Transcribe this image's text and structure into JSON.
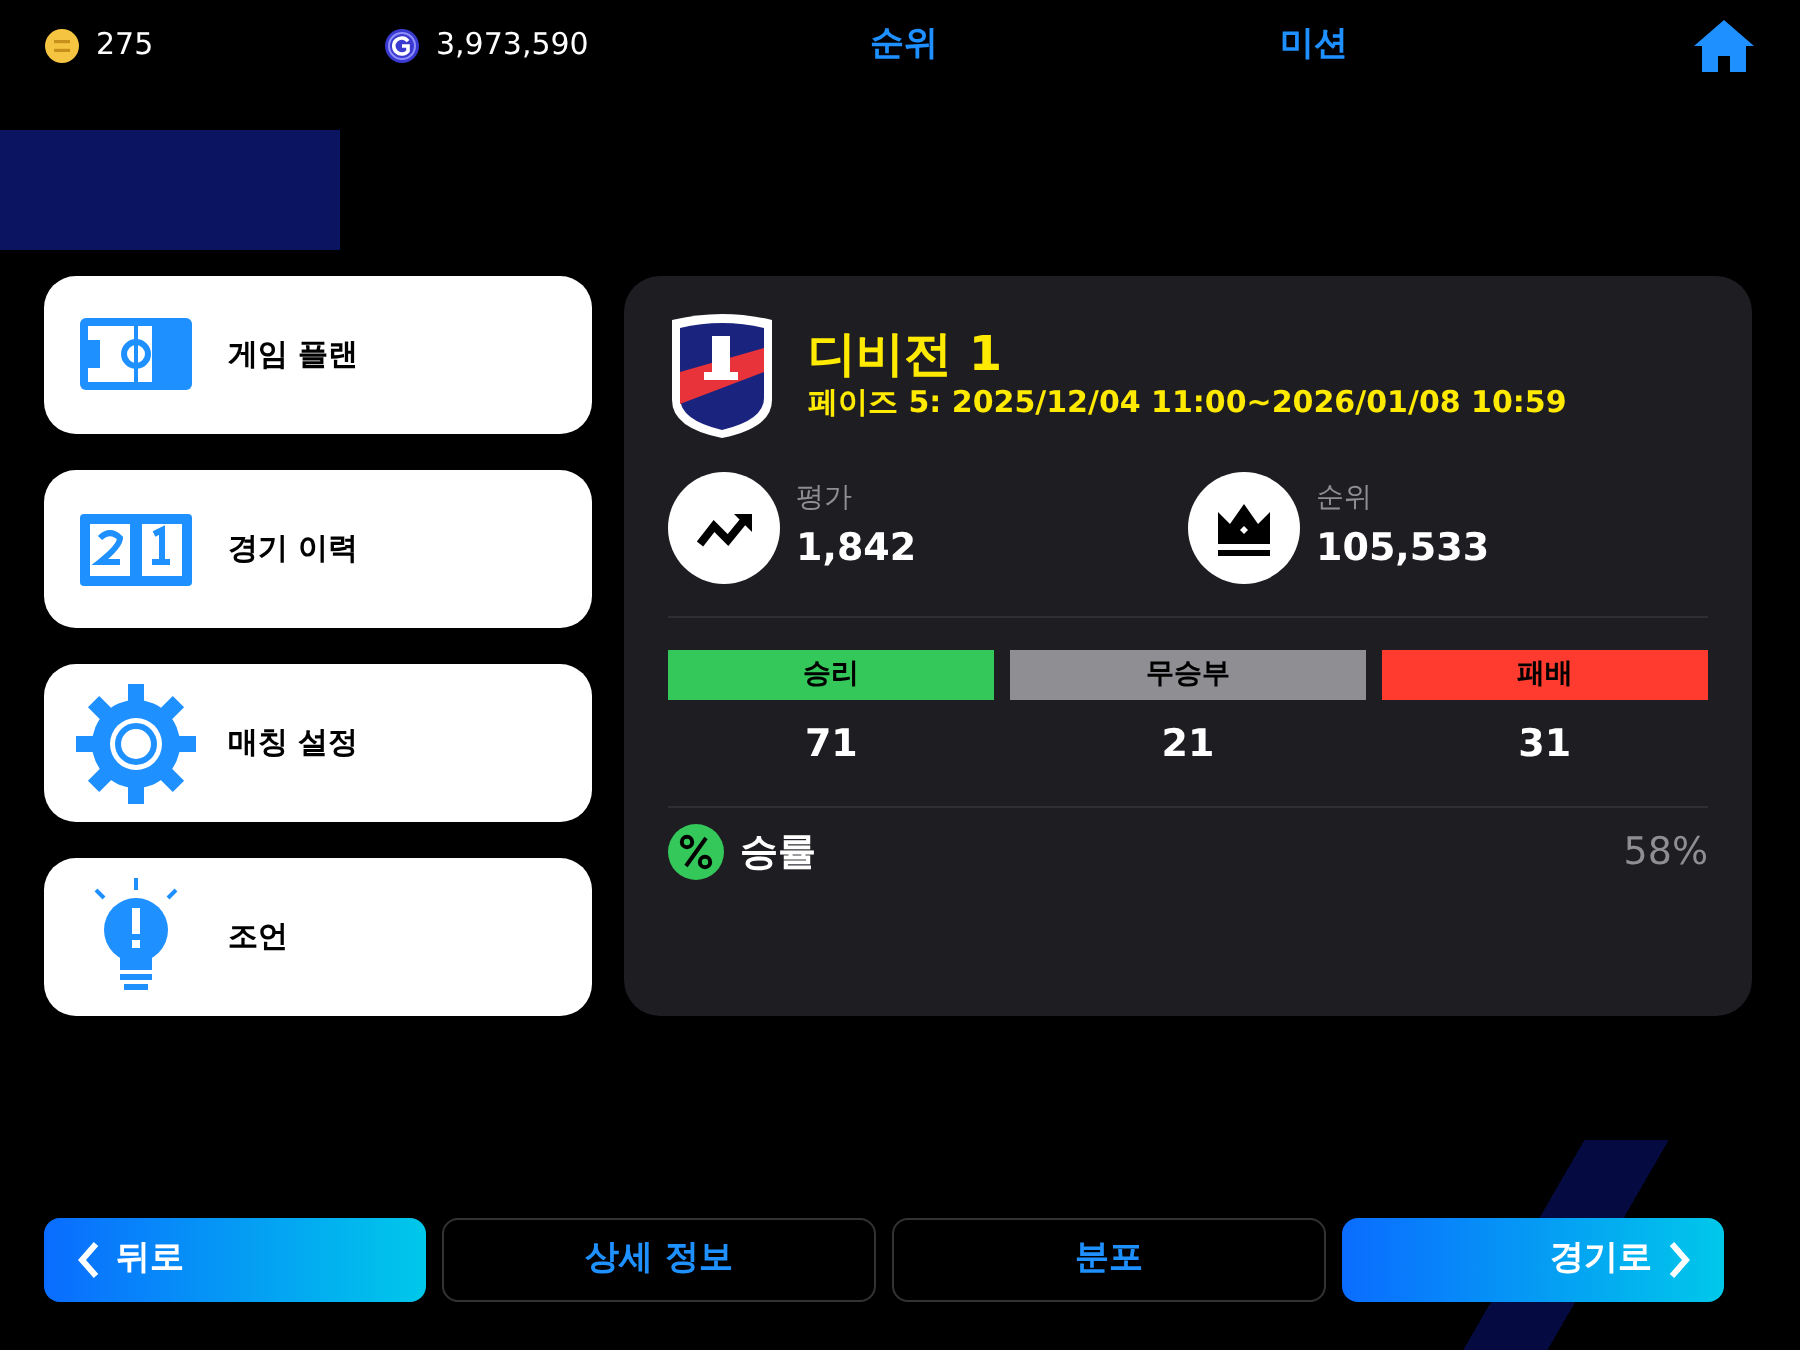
{
  "currencies": [
    {
      "kind": "coin",
      "value": "275"
    },
    {
      "kind": "gcoin",
      "value": "3,973,590"
    }
  ],
  "top_links": [
    "순위",
    "미션"
  ],
  "menu": [
    {
      "kind": "plan",
      "label": "게임 플랜"
    },
    {
      "kind": "history",
      "label": "경기 이력"
    },
    {
      "kind": "settings",
      "label": "매칭 설정"
    },
    {
      "kind": "tip",
      "label": "조언"
    }
  ],
  "division": {
    "title": "디비전 1",
    "period": "페이즈 5: 2025/12/04 11:00~2026/01/08 10:59",
    "stats": [
      {
        "kind": "rating",
        "label": "평가",
        "value": "1,842"
      },
      {
        "kind": "rank",
        "label": "순위",
        "value": "105,533"
      }
    ],
    "results": [
      {
        "label": "승리",
        "value": "71",
        "color": "#34c759"
      },
      {
        "label": "무승부",
        "value": "21",
        "color": "#8e8e93"
      },
      {
        "label": "패배",
        "value": "31",
        "color": "#ff3b30"
      }
    ],
    "win_rate": {
      "label": "승률",
      "value": "58%"
    }
  },
  "buttons": [
    {
      "kind": "back",
      "label": "뒤로"
    },
    {
      "kind": "outline",
      "label": "상세 정보"
    },
    {
      "kind": "outline",
      "label": "분포"
    },
    {
      "kind": "next",
      "label": "경기로"
    }
  ]
}
